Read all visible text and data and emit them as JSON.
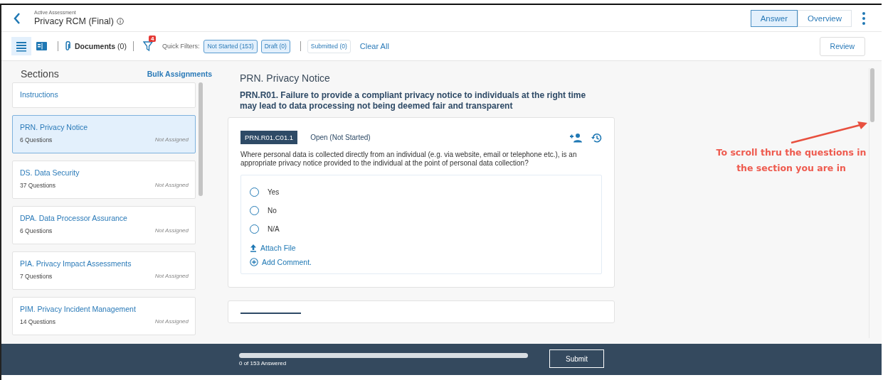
{
  "header": {
    "eyebrow": "Active Assessment",
    "title": "Privacy RCM (Final)",
    "view_tabs": [
      {
        "label": "Answer",
        "selected": true
      },
      {
        "label": "Overview",
        "selected": false
      }
    ]
  },
  "toolbar": {
    "layout_toggles": [
      {
        "kind": "list",
        "selected": true
      },
      {
        "kind": "split",
        "selected": false
      }
    ],
    "documents": "**Documents** (0)",
    "filter_badge": "4",
    "quick_filters_label": "Quick Filters:",
    "quick_filters": [
      {
        "label": "Not Started (153)",
        "selected": true
      },
      {
        "label": "Draft (0)",
        "selected": true
      },
      {
        "label": "Submitted (0)",
        "selected": false
      }
    ],
    "clear_all": "Clear All",
    "review": "Review"
  },
  "sidebar": {
    "title": "Sections",
    "action": "Bulk Assignments",
    "items": [
      {
        "kind": "link",
        "title": "Instructions",
        "selected": false
      },
      {
        "kind": "section",
        "title": "PRN. Privacy Notice",
        "questions": "6 Questions",
        "assignment": "Not Assigned",
        "selected": true
      },
      {
        "kind": "section",
        "title": "DS. Data Security",
        "questions": "37 Questions",
        "assignment": "Not Assigned",
        "selected": false
      },
      {
        "kind": "section",
        "title": "DPA. Data Processor Assurance",
        "questions": "6 Questions",
        "assignment": "Not Assigned",
        "selected": false
      },
      {
        "kind": "section",
        "title": "PIA. Privacy Impact Assessments",
        "questions": "7 Questions",
        "assignment": "Not Assigned",
        "selected": false
      },
      {
        "kind": "section",
        "title": "PIM. Privacy Incident Management",
        "questions": "14 Questions",
        "assignment": "Not Assigned",
        "selected": false
      }
    ]
  },
  "content": {
    "section_title": "PRN. Privacy Notice",
    "risk": "PRN.R01. Failure to provide a compliant privacy notice to individuals at the right time may lead to data processing not being deemed fair and transparent",
    "questions": [
      {
        "id": "PRN.R01.C01.1",
        "status": "Open (Not Started)",
        "text": "Where personal data is collected directly from an individual (e.g. via website, email or telephone etc.), is an appropriate privacy notice provided to the individual at the point of personal data collection?",
        "options": [
          {
            "label": "Yes",
            "checked": false
          },
          {
            "label": "No",
            "checked": false
          },
          {
            "label": "N/A",
            "checked": false
          }
        ],
        "actions": [
          {
            "kind": "attach",
            "label": "Attach File"
          },
          {
            "kind": "comment",
            "label": "Add Comment."
          }
        ]
      }
    ]
  },
  "annotation": {
    "text": "To scroll thru the questions in the section you are in"
  },
  "footer": {
    "progress": {
      "level": 0,
      "label": "0 of 153 Answered"
    },
    "submit": "Submit"
  }
}
